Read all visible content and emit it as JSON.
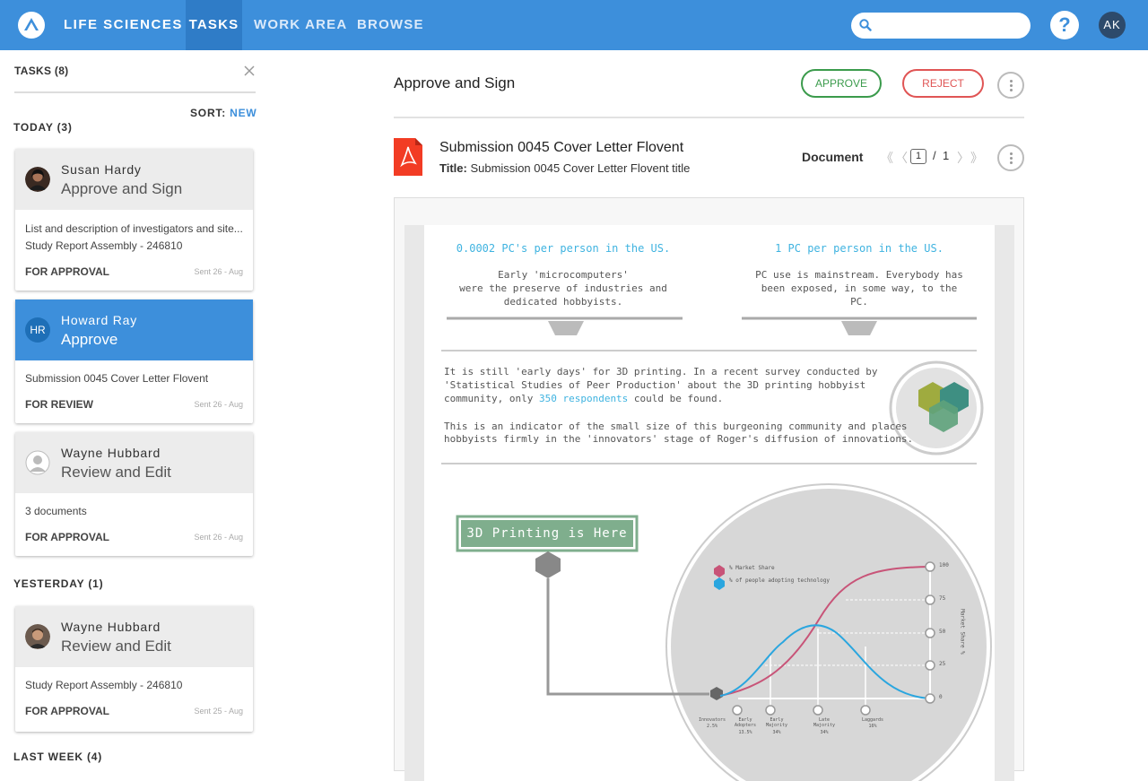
{
  "header": {
    "brand": "LIFE SCIENCES",
    "nav": [
      "TASKS",
      "WORK AREA",
      "BROWSE"
    ],
    "active_nav": "TASKS",
    "search_placeholder": "",
    "help_label": "?",
    "user_initials": "AK",
    "accent": "#3d8fdb"
  },
  "sidebar": {
    "title": "TASKS (8)",
    "sort_label": "SORT:",
    "sort_value": "NEW",
    "groups": [
      {
        "label": "TODAY (3)",
        "cards": [
          {
            "name": "Susan Hardy",
            "action": "Approve and Sign",
            "desc1": "List and description of investigators and site...",
            "desc2": "Study Report Assembly - 246810",
            "status": "FOR APPROVAL",
            "sent": "Sent 26 - Aug",
            "avatar": "photo"
          },
          {
            "name": "Howard Ray",
            "action": "Approve",
            "initials": "HR",
            "desc1": "Submission 0045 Cover Letter Flovent",
            "status": "FOR REVIEW",
            "sent": "Sent 26 - Aug",
            "selected": true
          },
          {
            "name": "Wayne Hubbard",
            "action": "Review and Edit",
            "desc1": "3 documents",
            "status": "FOR APPROVAL",
            "sent": "Sent 26 - Aug",
            "avatar": "placeholder"
          }
        ]
      },
      {
        "label": "YESTERDAY (1)",
        "cards": [
          {
            "name": "Wayne Hubbard",
            "action": "Review and Edit",
            "desc1": "Study Report Assembly - 246810",
            "status": "FOR APPROVAL",
            "sent": "Sent 25 - Aug",
            "avatar": "photo"
          }
        ]
      },
      {
        "label": "LAST WEEK (4)",
        "cards": []
      }
    ]
  },
  "main": {
    "title": "Approve and Sign",
    "approve_label": "APPROVE",
    "reject_label": "REJECT",
    "document": {
      "name": "Submission 0045 Cover Letter Flovent",
      "title_label": "Title:",
      "title_value": "Submission 0045 Cover Letter Flovent title",
      "type_label": "Document",
      "page_current": "1",
      "page_sep": "/",
      "page_total": "1"
    },
    "preview": {
      "stat_left": "0.0002 PC's per person in the US.",
      "stat_right": "1 PC per person in the US.",
      "desc_left": [
        "Early 'microcomputers'",
        "were the preserve of industries and",
        "dedicated hobbyists."
      ],
      "desc_right": [
        "PC use is mainstream. Everybody has",
        "been exposed, in some way, to the",
        "PC."
      ],
      "para1_a": "It is still 'early days' for 3D printing. In a recent survey conducted by",
      "para1_b": "'Statistical Studies of Peer Production'  about the 3D printing hobbyist",
      "para1_c": "community, only ",
      "para1_link": "350 respondents",
      "para1_d": " could be found.",
      "para2_a": "This is an indicator of the small size of this burgeoning community and places",
      "para2_b": "hobbyists firmly in the 'innovators' stage of Roger's diffusion of innovations.",
      "banner": "3D Printing is Here",
      "legend": [
        "% Market Share",
        "% of people adopting technology"
      ],
      "yticks": [
        "100",
        "75",
        "50",
        "25",
        "0"
      ],
      "yaxis": "Market Share %",
      "xcats": [
        {
          "name": "Innovators",
          "pct": "2.5%"
        },
        {
          "name": "Early Adopters",
          "pct": "13.5%"
        },
        {
          "name": "Early Majority",
          "pct": "34%"
        },
        {
          "name": "Late Majority",
          "pct": "34%"
        },
        {
          "name": "Laggards",
          "pct": "16%"
        }
      ]
    }
  }
}
